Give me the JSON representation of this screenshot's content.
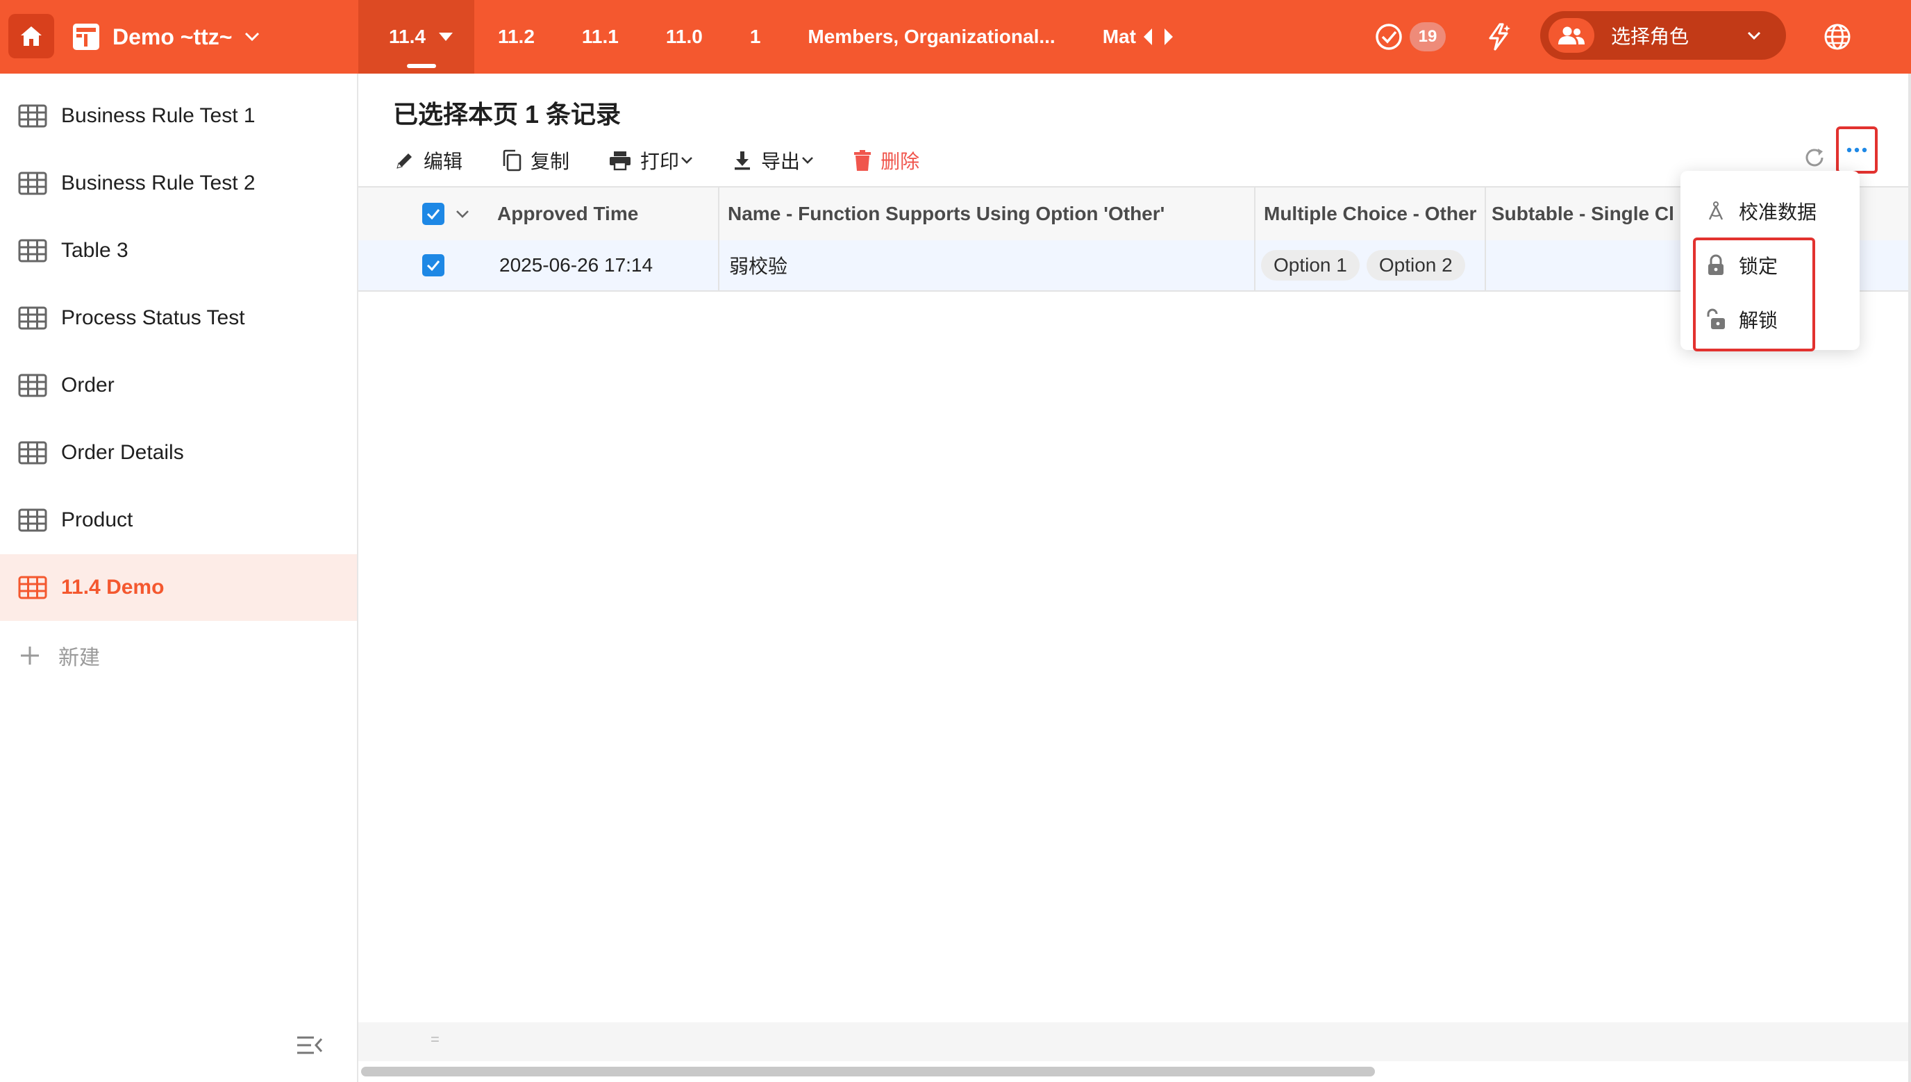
{
  "topbar": {
    "app_name": "Demo ~ttz~",
    "tabs": [
      {
        "label": "11.4"
      },
      {
        "label": "11.2"
      },
      {
        "label": "11.1"
      },
      {
        "label": "11.0"
      },
      {
        "label": "1"
      },
      {
        "label": "Members, Organizational..."
      },
      {
        "label": "Mat"
      }
    ],
    "todo_count": "19",
    "role_label": "选择角色",
    "brand_color": "#f4582f"
  },
  "sidebar": {
    "items": [
      {
        "label": "Business Rule Test 1"
      },
      {
        "label": "Business Rule Test 2"
      },
      {
        "label": "Table 3"
      },
      {
        "label": "Process Status Test"
      },
      {
        "label": "Order"
      },
      {
        "label": "Order Details"
      },
      {
        "label": "Product"
      },
      {
        "label": "11.4 Demo"
      }
    ],
    "new_label": "新建",
    "active_item": "11.4 Demo"
  },
  "main": {
    "title": "已选择本页 1 条记录",
    "toolbar": {
      "edit": "编辑",
      "copy": "复制",
      "print": "打印",
      "export": "导出",
      "delete": "删除"
    },
    "columns": [
      "Approved Time",
      "Name - Function Supports Using Option 'Other'",
      "Multiple Choice - Other",
      "Subtable - Single Cl"
    ],
    "rows": [
      {
        "approved_time": "2025-06-26 17:14",
        "name": "弱校验",
        "multiple_choice": [
          "Option 1",
          "Option 2"
        ],
        "subtable": ""
      }
    ],
    "footer_hint": "="
  },
  "more_menu": {
    "items": [
      {
        "label": "校准数据",
        "icon": "calibrate-icon"
      },
      {
        "label": "锁定",
        "icon": "lock-icon"
      },
      {
        "label": "解锁",
        "icon": "unlock-icon"
      }
    ]
  }
}
